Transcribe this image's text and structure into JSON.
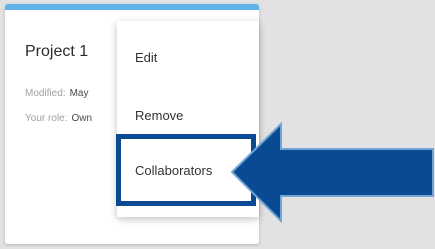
{
  "card": {
    "title": "Project 1",
    "modified_label": "Modified:",
    "modified_value": "May",
    "role_label": "Your role:",
    "role_value": "Own"
  },
  "menu": {
    "items": [
      {
        "label": "Edit"
      },
      {
        "label": "Remove"
      },
      {
        "label": "Collaborators"
      }
    ]
  },
  "colors": {
    "background": "#e2e2e4",
    "card_accent": "#5fb3e8",
    "highlight_border": "#0a4a93",
    "arrow_fill": "#0a4a93",
    "arrow_stroke": "#6fa6d6"
  },
  "annotation": {
    "target": "Collaborators",
    "pointer": "arrow-left"
  }
}
